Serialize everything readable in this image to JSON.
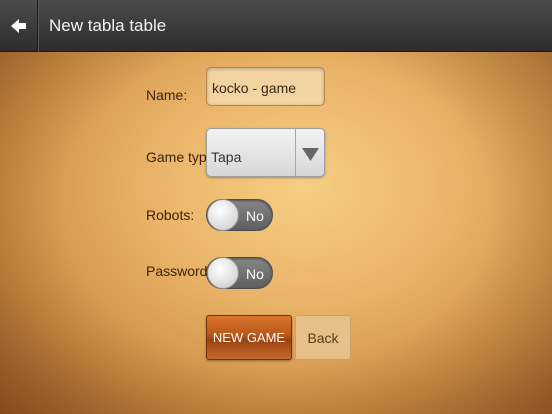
{
  "header": {
    "back_icon": "arrow-left-icon",
    "title": "New tabla table"
  },
  "form": {
    "name_label": "Name:",
    "name_value": "kocko - game",
    "game_type_label": "Game type:",
    "game_type_value": "Tapa",
    "game_type_icon": "triangle-down-icon",
    "robots_label": "Robots:",
    "robots_value": "No",
    "password_label": "Password:",
    "password_value": "No"
  },
  "actions": {
    "new_game_label": "NEW GAME",
    "back_label": "Back"
  },
  "colors": {
    "header_bg": "#3a3a3a",
    "background": "#e9b469",
    "new_game_button": "#b9561a",
    "back_button": "#e7c089"
  }
}
